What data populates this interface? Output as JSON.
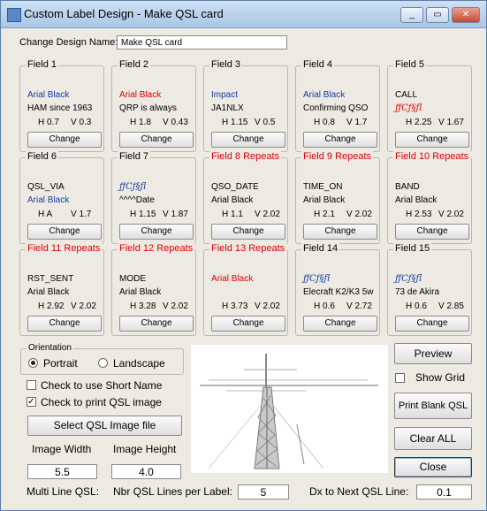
{
  "window": {
    "title": "Custom Label Design - Make QSL card",
    "min_glyph": "_",
    "max_glyph": "▭",
    "close_glyph": "✕"
  },
  "design_name": {
    "label": "Change Design Name:",
    "value": "Make QSL card"
  },
  "change_label": "Change",
  "fields": [
    {
      "title": "Field 1",
      "title_red": false,
      "line1": "Arial Black",
      "line1_class": "blue",
      "line2": "HAM since 1963",
      "line2_class": "",
      "h": "H 0.7",
      "v": "V 0.3"
    },
    {
      "title": "Field 2",
      "title_red": false,
      "line1": "Arial Black",
      "line1_class": "red",
      "line2": "QRP is always",
      "line2_class": "",
      "h": "H 1.8",
      "v": "V 0.43"
    },
    {
      "title": "Field 3",
      "title_red": false,
      "line1": "Impact",
      "line1_class": "blue",
      "line2": "JA1NLX",
      "line2_class": "",
      "h": "H 1.15",
      "v": "V 0.5"
    },
    {
      "title": "Field 4",
      "title_red": false,
      "line1": "Arial Black",
      "line1_class": "blue",
      "line2": "Confirming QSO",
      "line2_class": "",
      "h": "H 0.8",
      "v": "V 1.7"
    },
    {
      "title": "Field 5",
      "title_red": false,
      "line1": "CALL",
      "line1_class": "",
      "line2": "ƒƒCƒ§ƒl",
      "line2_class": "red sym",
      "h": "H 2.25",
      "v": "V 1.67"
    },
    {
      "title": "Field 6",
      "title_red": false,
      "line1": "QSL_VIA",
      "line1_class": "",
      "line2": "Arial Black",
      "line2_class": "blue",
      "h": "H A",
      "v": "V 1.7"
    },
    {
      "title": "Field 7",
      "title_red": false,
      "line1": "ƒƒCƒ§ƒl",
      "line1_class": "blue sym",
      "line2": "^^^^Date",
      "line2_class": "",
      "h": "H 1.15",
      "v": "V 1.87"
    },
    {
      "title": "Field 8 Repeats",
      "title_red": true,
      "line1": "QSO_DATE",
      "line1_class": "",
      "line2": "Arial Black",
      "line2_class": "",
      "h": "H 1.1",
      "v": "V 2.02"
    },
    {
      "title": "Field 9 Repeats",
      "title_red": true,
      "line1": "TIME_ON",
      "line1_class": "",
      "line2": "Arial Black",
      "line2_class": "",
      "h": "H 2.1",
      "v": "V 2.02"
    },
    {
      "title": "Field 10 Repeats",
      "title_red": true,
      "line1": "BAND",
      "line1_class": "",
      "line2": "Arial Black",
      "line2_class": "",
      "h": "H 2.53",
      "v": "V 2.02"
    },
    {
      "title": "Field 11 Repeats",
      "title_red": true,
      "line1": "RST_SENT",
      "line1_class": "",
      "line2": "Arial Black",
      "line2_class": "",
      "h": "H 2.92",
      "v": "V 2.02"
    },
    {
      "title": "Field 12 Repeats",
      "title_red": true,
      "line1": "MODE",
      "line1_class": "",
      "line2": "Arial Black",
      "line2_class": "",
      "h": "H 3.28",
      "v": "V 2.02"
    },
    {
      "title": "Field 13 Repeats",
      "title_red": true,
      "line1": "Arial Black",
      "line1_class": "red",
      "line2": "",
      "line2_class": "",
      "h": "H 3.73",
      "v": "V 2.02"
    },
    {
      "title": "Field 14",
      "title_red": false,
      "line1": "ƒƒCƒ§ƒl",
      "line1_class": "blue sym",
      "line2": "Elecraft K2/K3 5w",
      "line2_class": "",
      "h": "H 0.6",
      "v": "V 2.72"
    },
    {
      "title": "Field 15",
      "title_red": false,
      "line1": "ƒƒCƒ§ƒl",
      "line1_class": "blue sym",
      "line2": "73 de Akira",
      "line2_class": "",
      "h": "H 0.6",
      "v": "V 2.85"
    }
  ],
  "orientation": {
    "title": "Orientation",
    "portrait": "Portrait",
    "landscape": "Landscape",
    "selected": "portrait"
  },
  "short_name": {
    "label": "Check to use Short Name",
    "checked": false
  },
  "print_qsl": {
    "label": "Check to print QSL image",
    "checked": true
  },
  "select_image_label": "Select QSL Image file",
  "image_width": {
    "label": "Image Width",
    "value": "5.5"
  },
  "image_height": {
    "label": "Image Height",
    "value": "4.0"
  },
  "multi_line": {
    "label": "Multi Line QSL:"
  },
  "nbr_lines": {
    "label": "Nbr QSL Lines per Label:",
    "value": "5"
  },
  "dx_next": {
    "label": "Dx to Next QSL Line:",
    "value": "0.1"
  },
  "buttons": {
    "preview": "Preview",
    "show_grid": "Show Grid",
    "print_blank": "Print Blank QSL",
    "clear_all": "Clear ALL",
    "close": "Close"
  },
  "show_grid_checked": false
}
